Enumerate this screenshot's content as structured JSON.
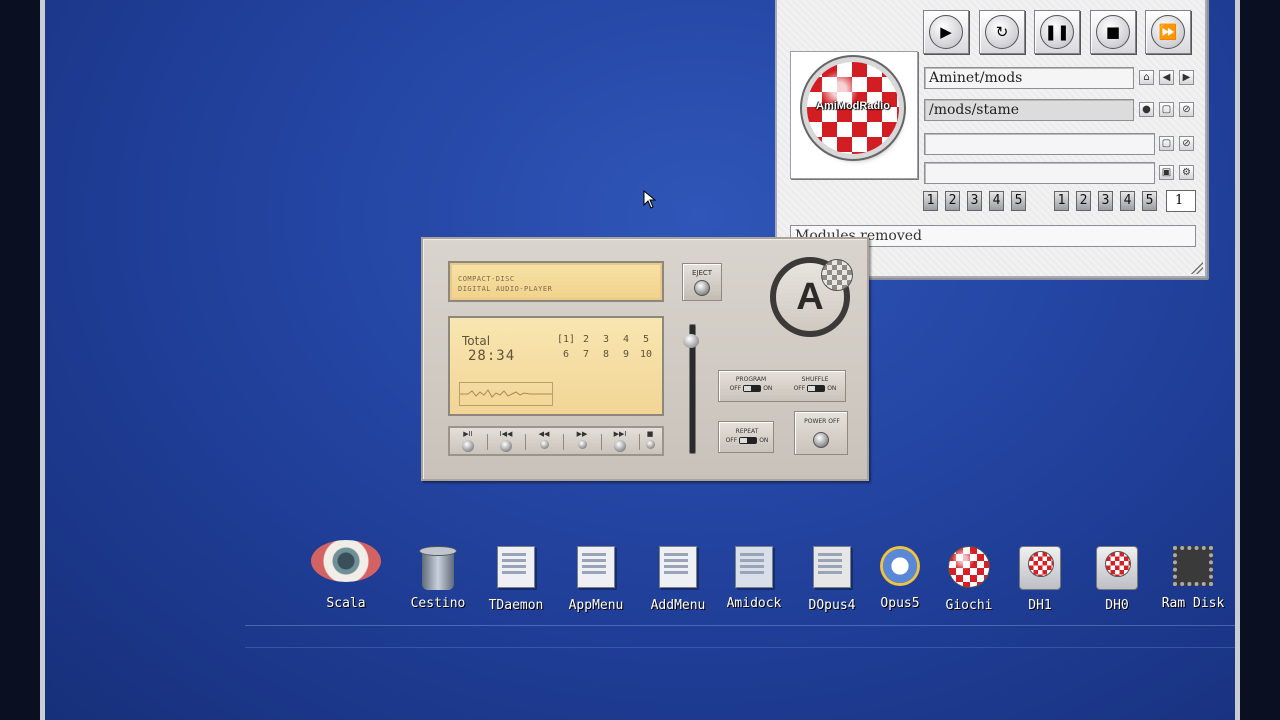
{
  "radio": {
    "logo_text": "AmiModRadio",
    "path1": "Aminet/mods",
    "path2": "/mods/stame",
    "path3": "",
    "path4": "",
    "group1": [
      "1",
      "2",
      "3",
      "4",
      "5"
    ],
    "group2": [
      "1",
      "2",
      "3",
      "4",
      "5"
    ],
    "count_value": "1",
    "status": "Modules removed",
    "icons": {
      "play": "play-icon",
      "loop": "repeat-icon",
      "pause": "pause-icon",
      "stop": "stop-icon",
      "next": "fast-forward-icon"
    }
  },
  "cd_player": {
    "lcd_line1": "COMPACT-DISC",
    "lcd_line2": "DIGITAL AUDIO-PLAYER",
    "total_label": "Total",
    "total_time": "28:34",
    "tracks_row1": [
      "[1]",
      "2",
      "3",
      "4",
      "5"
    ],
    "tracks_row2": [
      "6",
      "7",
      "8",
      "9",
      "10"
    ],
    "transport_labels": [
      "▶II",
      "I◀◀",
      "◀◀",
      "▶▶",
      "▶▶I",
      "■"
    ],
    "eject_label": "EJECT",
    "program_label": "PROGRAM",
    "shuffle_label": "SHUFFLE",
    "repeat_label": "REPEAT",
    "power_label": "POWER OFF",
    "off_label": "OFF",
    "on_label": "ON",
    "brand_letter": "A"
  },
  "desktop_icons": [
    {
      "name": "Scala",
      "icon": "eye-icon"
    },
    {
      "name": "Cestino",
      "icon": "trash-icon"
    },
    {
      "name": "TDaemon",
      "icon": "tdaemon-icon"
    },
    {
      "name": "AppMenu",
      "icon": "appmenu-icon"
    },
    {
      "name": "AddMenu",
      "icon": "addmenu-icon"
    },
    {
      "name": "Amidock",
      "icon": "amidock-icon"
    },
    {
      "name": "DOpus4",
      "icon": "dopus-icon"
    },
    {
      "name": "Opus5",
      "icon": "opus-icon"
    },
    {
      "name": "Giochi",
      "icon": "boing-ball-icon"
    },
    {
      "name": "DH1",
      "icon": "drive-icon"
    },
    {
      "name": "DH0",
      "icon": "drive-icon"
    },
    {
      "name": "Ram Disk",
      "icon": "chip-icon"
    }
  ],
  "colors": {
    "desktop": "#2547a6",
    "boing_red": "#d21d23",
    "lcd": "#f2d596"
  }
}
